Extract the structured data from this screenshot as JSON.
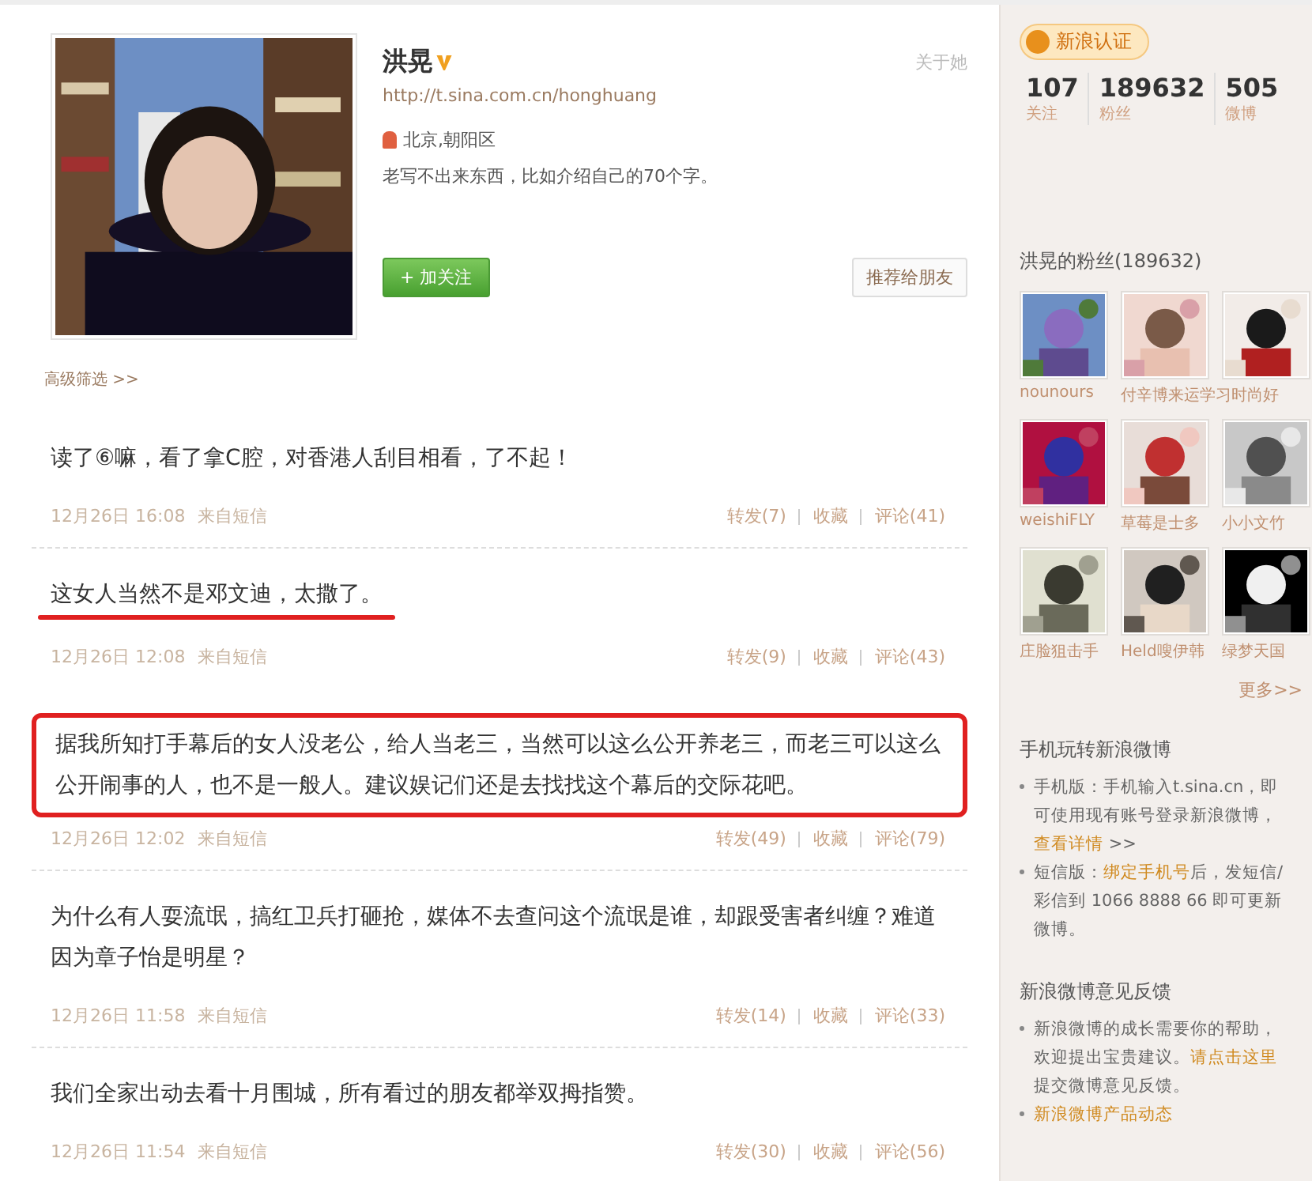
{
  "profile": {
    "name": "洪晃",
    "verified": true,
    "url": "http://t.sina.com.cn/honghuang",
    "location": "北京,朝阳区",
    "bio": "老写不出来东西，比如介绍自己的70个字。",
    "about_link": "关于她",
    "follow_button": "+ 加关注",
    "recommend_button": "推荐给朋友",
    "photo": {
      "kind": "picture"
    }
  },
  "filter_link": "高级筛选 >>",
  "posts": [
    {
      "text": "读了⑥嘛，看了拿C腔，对香港人刮目相看，了不起！",
      "time": "12月26日 16:08",
      "source": "来自短信",
      "repost": "转发(7)",
      "favorite": "收藏",
      "comment": "评论(41)",
      "underlined": false,
      "boxed": false
    },
    {
      "text": "这女人当然不是邓文迪，太撒了。",
      "time": "12月26日 12:08",
      "source": "来自短信",
      "repost": "转发(9)",
      "favorite": "收藏",
      "comment": "评论(43)",
      "underlined": true,
      "boxed": false
    },
    {
      "text": "据我所知打手幕后的女人没老公，给人当老三，当然可以这么公开养老三，而老三可以这么公开闹事的人，也不是一般人。建议娱记们还是去找找这个幕后的交际花吧。",
      "time": "12月26日 12:02",
      "source": "来自短信",
      "repost": "转发(49)",
      "favorite": "收藏",
      "comment": "评论(79)",
      "underlined": false,
      "boxed": true
    },
    {
      "text": "为什么有人耍流氓，搞红卫兵打砸抢，媒体不去查问这个流氓是谁，却跟受害者纠缠？难道因为章子怡是明星？",
      "time": "12月26日 11:58",
      "source": "来自短信",
      "repost": "转发(14)",
      "favorite": "收藏",
      "comment": "评论(33)",
      "underlined": false,
      "boxed": false
    },
    {
      "text": "我们全家出动去看十月围城，所有看过的朋友都举双拇指赞。",
      "time": "12月26日 11:54",
      "source": "来自短信",
      "repost": "转发(30)",
      "favorite": "收藏",
      "comment": "评论(56)",
      "underlined": false,
      "boxed": false
    }
  ],
  "sidebar": {
    "badge": "新浪认证",
    "stats": [
      {
        "value": "107",
        "label": "关注"
      },
      {
        "value": "189632",
        "label": "粉丝"
      },
      {
        "value": "505",
        "label": "微博"
      }
    ],
    "fans_title": "洪晃的粉丝(189632)",
    "fans": [
      {
        "name": "nounours",
        "picture": {
          "kind": "picture"
        }
      },
      {
        "name": "付辛博来运学习时尚好",
        "picture": {
          "kind": "picture"
        }
      },
      {
        "picture": {
          "kind": "picture"
        }
      },
      {
        "name": "weishiFLY",
        "picture": {
          "kind": "picture"
        }
      },
      {
        "name": "草莓是士多",
        "picture": {
          "kind": "picture"
        }
      },
      {
        "name": "小小文竹",
        "picture": {
          "kind": "picture"
        }
      },
      {
        "name": "庄脸狙击手",
        "picture": {
          "kind": "picture"
        }
      },
      {
        "name": "Held嗖伊韩",
        "picture": {
          "kind": "picture"
        }
      },
      {
        "name": "绿梦天国",
        "picture": {
          "kind": "picture"
        }
      }
    ],
    "more_link": "更多>>",
    "sections": [
      {
        "title": "手机玩转新浪微博",
        "items": [
          [
            {
              "kind": "text",
              "text": "手机版：手机输入t.sina.cn，即可使用现有账号登录新浪微博，"
            },
            {
              "kind": "link",
              "text": "查看详情"
            },
            {
              "kind": "text",
              "text": " >>"
            }
          ],
          [
            {
              "kind": "text",
              "text": "短信版："
            },
            {
              "kind": "link",
              "text": "绑定手机号"
            },
            {
              "kind": "text",
              "text": "后，发短信/彩信到 1066 8888 66 即可更新微博。"
            }
          ]
        ]
      },
      {
        "title": "新浪微博意见反馈",
        "items": [
          [
            {
              "kind": "text",
              "text": "新浪微博的成长需要你的帮助，欢迎提出宝贵建议。"
            },
            {
              "kind": "link",
              "text": "请点击这里"
            },
            {
              "kind": "text",
              "text": "提交微博意见反馈。"
            }
          ],
          [
            {
              "kind": "link",
              "text": "新浪微博产品动态"
            }
          ]
        ]
      }
    ]
  }
}
